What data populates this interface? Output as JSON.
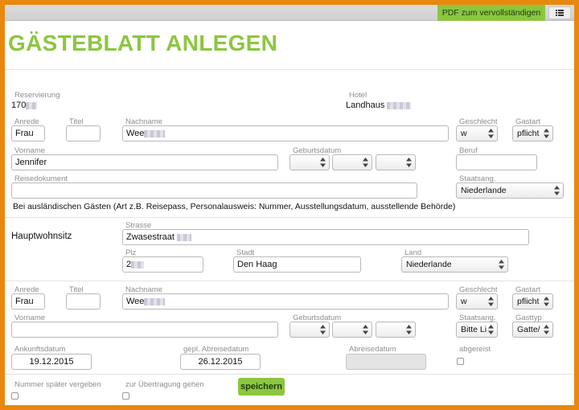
{
  "header": {
    "pdf_button": "PDF zum vervollständigen",
    "title": "GÄSTEBLATT ANLEGEN"
  },
  "reservation": {
    "label": "Reservierung",
    "value": "170",
    "hotel_label": "Hotel",
    "hotel_value": "Landhaus"
  },
  "guest1": {
    "anrede_label": "Anrede",
    "anrede": "Frau",
    "titel_label": "Titel",
    "titel": "",
    "nachname_label": "Nachname",
    "nachname": "Wee",
    "geschlecht_label": "Geschlecht",
    "geschlecht": "w",
    "gastart_label": "Gastart",
    "gastart": "pflicht",
    "vorname_label": "Vorname",
    "vorname": "Jennifer",
    "geburtsdatum_label": "Geburtsdatum",
    "beruf_label": "Beruf",
    "beruf": "",
    "reisedokument_label": "Reisedokument",
    "reisedokument": "",
    "staatsang_label": "Staatsang.",
    "staatsang": "Niederlande",
    "note": "Bei ausländischen Gästen (Art z.B. Reisepass, Personalausweis: Nummer, Ausstellungsdatum, ausstellende Behörde)"
  },
  "address": {
    "section_title": "Hauptwohnsitz",
    "strasse_label": "Strasse",
    "strasse": "Zwasestraat",
    "plz_label": "Plz",
    "plz": "2",
    "stadt_label": "Stadt",
    "stadt": "Den Haag",
    "land_label": "Land",
    "land": "Niederlande"
  },
  "guest2": {
    "anrede_label": "Anrede",
    "anrede": "Frau",
    "titel_label": "Titel",
    "titel": "",
    "nachname_label": "Nachname",
    "nachname": "Wee",
    "geschlecht_label": "Geschlecht",
    "geschlecht": "w",
    "gastart_label": "Gastart",
    "gastart": "pflicht",
    "vorname_label": "Vorname",
    "vorname": "",
    "geburtsdatum_label": "Geburtsdatum",
    "staatsang_label": "Staatsang.",
    "staatsang": "Bitte Li",
    "gasttyp_label": "Gasttyp",
    "gasttyp": "Gatte/"
  },
  "stay": {
    "ankunft_label": "Ankunftsdatum",
    "ankunft": "19.12.2015",
    "abreise_gepl_label": "gepl. Abreisedatum",
    "abreise_gepl": "26.12.2015",
    "abreise_label": "Abreisedatum",
    "abreise": "",
    "abgereist_label": "abgereist"
  },
  "footer": {
    "nummer_label": "Nummer später vergeben",
    "uebertragung_label": "zur Übertragung gehen",
    "save_button": "speichern"
  },
  "colors": {
    "accent": "#8cc63f",
    "frame": "#e8880c"
  },
  "icons": [
    "menu-icon",
    "select-arrows-icon"
  ]
}
